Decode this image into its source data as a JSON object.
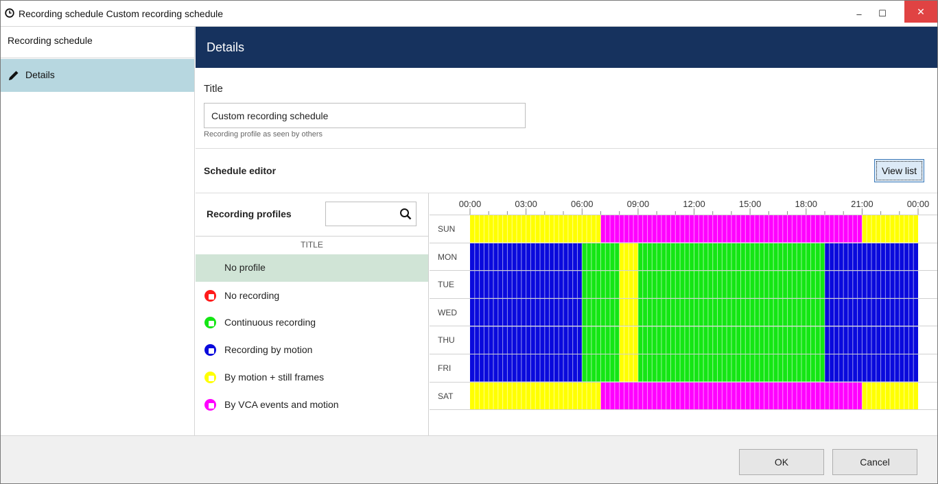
{
  "window": {
    "title": "Recording schedule Custom recording schedule",
    "minimize": "–",
    "maximize": "☐",
    "close": "✕"
  },
  "sidebar": {
    "header": "Recording schedule",
    "items": [
      {
        "label": "Details",
        "icon": "pencil-icon"
      }
    ]
  },
  "main": {
    "header": "Details",
    "title_label": "Title",
    "title_value": "Custom recording schedule",
    "title_hint": "Recording profile as seen by others",
    "schedule_editor_label": "Schedule editor",
    "view_list_label": "View list"
  },
  "profiles": {
    "heading": "Recording profiles",
    "search_value": "",
    "column_title": "TITLE",
    "items": [
      {
        "label": "No profile",
        "color": "",
        "selected": true
      },
      {
        "label": "No recording",
        "color": "#ff1a1a",
        "selected": false
      },
      {
        "label": "Continuous recording",
        "color": "#14e614",
        "selected": false
      },
      {
        "label": "Recording by motion",
        "color": "#0a0adc",
        "selected": false
      },
      {
        "label": "By motion + still frames",
        "color": "#ffff00",
        "selected": false
      },
      {
        "label": "By VCA events and motion",
        "color": "#ff00ff",
        "selected": false
      }
    ]
  },
  "schedule": {
    "hour_labels": [
      "00:00",
      "03:00",
      "06:00",
      "09:00",
      "12:00",
      "15:00",
      "18:00",
      "21:00",
      "00:00"
    ],
    "slot_minutes": 15,
    "colors": {
      "motion_still": "#ffff00",
      "vca_motion": "#ff00ff",
      "continuous": "#14e614",
      "motion": "#0a0adc"
    },
    "days": [
      {
        "day": "SUN",
        "segments": [
          {
            "from": "00:00",
            "to": "07:00",
            "profile": "motion_still"
          },
          {
            "from": "07:00",
            "to": "21:00",
            "profile": "vca_motion"
          },
          {
            "from": "21:00",
            "to": "24:00",
            "profile": "motion_still"
          }
        ]
      },
      {
        "day": "MON",
        "segments": [
          {
            "from": "00:00",
            "to": "06:00",
            "profile": "motion"
          },
          {
            "from": "06:00",
            "to": "08:00",
            "profile": "continuous"
          },
          {
            "from": "08:00",
            "to": "09:00",
            "profile": "motion_still"
          },
          {
            "from": "09:00",
            "to": "19:00",
            "profile": "continuous"
          },
          {
            "from": "19:00",
            "to": "24:00",
            "profile": "motion"
          }
        ]
      },
      {
        "day": "TUE",
        "segments": [
          {
            "from": "00:00",
            "to": "06:00",
            "profile": "motion"
          },
          {
            "from": "06:00",
            "to": "08:00",
            "profile": "continuous"
          },
          {
            "from": "08:00",
            "to": "09:00",
            "profile": "motion_still"
          },
          {
            "from": "09:00",
            "to": "19:00",
            "profile": "continuous"
          },
          {
            "from": "19:00",
            "to": "24:00",
            "profile": "motion"
          }
        ]
      },
      {
        "day": "WED",
        "segments": [
          {
            "from": "00:00",
            "to": "06:00",
            "profile": "motion"
          },
          {
            "from": "06:00",
            "to": "08:00",
            "profile": "continuous"
          },
          {
            "from": "08:00",
            "to": "09:00",
            "profile": "motion_still"
          },
          {
            "from": "09:00",
            "to": "19:00",
            "profile": "continuous"
          },
          {
            "from": "19:00",
            "to": "24:00",
            "profile": "motion"
          }
        ]
      },
      {
        "day": "THU",
        "segments": [
          {
            "from": "00:00",
            "to": "06:00",
            "profile": "motion"
          },
          {
            "from": "06:00",
            "to": "08:00",
            "profile": "continuous"
          },
          {
            "from": "08:00",
            "to": "09:00",
            "profile": "motion_still"
          },
          {
            "from": "09:00",
            "to": "19:00",
            "profile": "continuous"
          },
          {
            "from": "19:00",
            "to": "24:00",
            "profile": "motion"
          }
        ]
      },
      {
        "day": "FRI",
        "segments": [
          {
            "from": "00:00",
            "to": "06:00",
            "profile": "motion"
          },
          {
            "from": "06:00",
            "to": "08:00",
            "profile": "continuous"
          },
          {
            "from": "08:00",
            "to": "09:00",
            "profile": "motion_still"
          },
          {
            "from": "09:00",
            "to": "19:00",
            "profile": "continuous"
          },
          {
            "from": "19:00",
            "to": "24:00",
            "profile": "motion"
          }
        ]
      },
      {
        "day": "SAT",
        "segments": [
          {
            "from": "00:00",
            "to": "07:00",
            "profile": "motion_still"
          },
          {
            "from": "07:00",
            "to": "21:00",
            "profile": "vca_motion"
          },
          {
            "from": "21:00",
            "to": "24:00",
            "profile": "motion_still"
          }
        ]
      }
    ]
  },
  "footer": {
    "ok_label": "OK",
    "cancel_label": "Cancel"
  }
}
